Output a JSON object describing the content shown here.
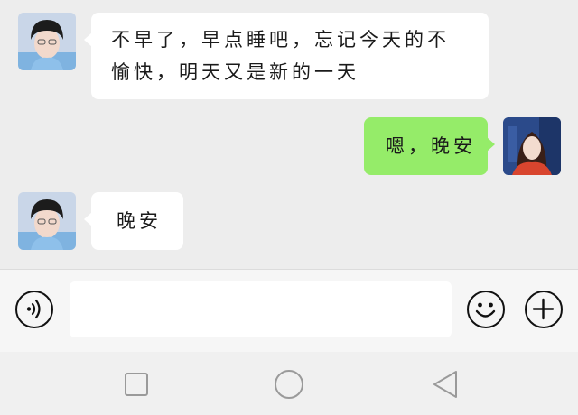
{
  "messages": [
    {
      "direction": "incoming",
      "lines": [
        "不早了，早点睡吧，忘记今天的不",
        "愉快，明天又是新的一天"
      ]
    },
    {
      "direction": "outgoing",
      "lines": [
        "嗯，晚安"
      ]
    },
    {
      "direction": "incoming",
      "lines": [
        "晚安"
      ]
    }
  ],
  "input": {
    "placeholder": "",
    "value": ""
  },
  "icons": {
    "voice": "voice-wave-icon",
    "emoji": "smiley-icon",
    "more": "plus-icon",
    "recent": "square-icon",
    "home": "circle-icon",
    "back": "triangle-back-icon"
  },
  "colors": {
    "background": "#ededed",
    "incoming_bubble": "#ffffff",
    "outgoing_bubble": "#95ec69",
    "input_bar": "#f6f6f6",
    "nav_bar": "#f0f0f0"
  }
}
